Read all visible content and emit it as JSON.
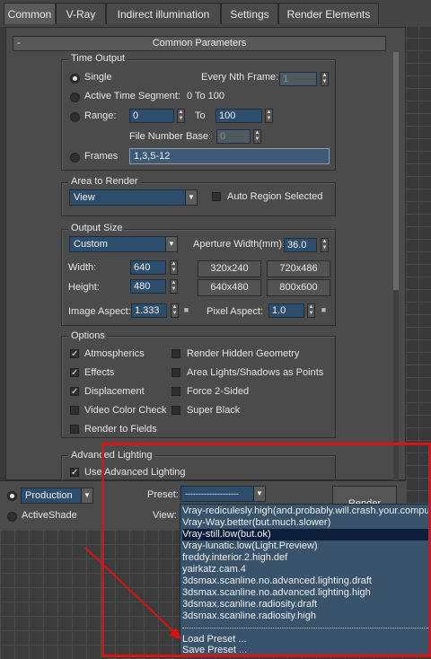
{
  "tabs": [
    "Common",
    "V-Ray",
    "Indirect illumination",
    "Settings",
    "Render Elements"
  ],
  "rollout": {
    "collapse_symbol": "-",
    "title": "Common Parameters"
  },
  "time_output": {
    "title": "Time Output",
    "single": "Single",
    "every_nth_frame_label": "Every Nth Frame:",
    "every_nth_frame_value": "1",
    "active_time_segment": "Active Time Segment:",
    "active_time_segment_value": "0 To 100",
    "range": "Range:",
    "range_from": "0",
    "range_to_label": "To",
    "range_to": "100",
    "file_number_base_label": "File Number Base:",
    "file_number_base_value": "0",
    "frames": "Frames",
    "frames_value": "1,3,5-12"
  },
  "area_to_render": {
    "title": "Area to Render",
    "dropdown_value": "View",
    "auto_region": "Auto Region Selected"
  },
  "output_size": {
    "title": "Output Size",
    "preset_value": "Custom",
    "aperture_label": "Aperture Width(mm):",
    "aperture_value": "36.0",
    "width_label": "Width:",
    "width_value": "640",
    "height_label": "Height:",
    "height_value": "480",
    "presets": [
      "320x240",
      "720x486",
      "640x480",
      "800x600"
    ],
    "image_aspect_label": "Image Aspect:",
    "image_aspect_value": "1.333",
    "pixel_aspect_label": "Pixel Aspect:",
    "pixel_aspect_value": "1.0"
  },
  "options": {
    "title": "Options",
    "atmospherics": "Atmospherics",
    "effects": "Effects",
    "displacement": "Displacement",
    "video_color_check": "Video Color Check",
    "render_to_fields": "Render to Fields",
    "render_hidden_geometry": "Render Hidden Geometry",
    "area_lights": "Area Lights/Shadows as Points",
    "force_2_sided": "Force 2-Sided",
    "super_black": "Super Black"
  },
  "advanced_lighting": {
    "title": "Advanced Lighting",
    "use_advanced_lighting": "Use Advanced Lighting"
  },
  "bottom": {
    "production": "Production",
    "activeshade": "ActiveShade",
    "preset_label": "Preset:",
    "preset_value": "--------------------",
    "view_label": "View:",
    "render_button": "Render"
  },
  "preset_list": {
    "items": [
      "Vray-rediculesly.high(and.probably.will.crash.your.computer",
      "Vray-Way.better(but.much.slower)",
      "Vray-still.low(but.ok)",
      "Vray-lunatic.low(Light.Preview)",
      "freddy.interior.2.high.def",
      "yairkatz.cam.4",
      "3dsmax.scanline.no.advanced.lighting.draft",
      "3dsmax.scanline.no.advanced.lighting.high",
      "3dsmax.scanline.radiosity.draft",
      "3dsmax.scanline.radiosity.high"
    ],
    "load_preset": "Load Preset ...",
    "save_preset": "Save Preset ..."
  },
  "colors": {
    "highlight": "#e01010",
    "field": "#2c4e6c",
    "selection": "#0b1f3a"
  }
}
